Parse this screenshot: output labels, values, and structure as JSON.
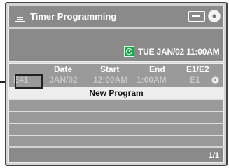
{
  "window": {
    "title": "Timer Programming",
    "left_icon": "menu-icon",
    "right_icons": [
      "media-icon",
      "disc-icon"
    ]
  },
  "status": {
    "clock_icon": "clock-icon",
    "datetime": "TUE JAN/02 11:00AM"
  },
  "table": {
    "columns": [
      "Date",
      "Start",
      "End",
      "E1/E2"
    ],
    "rows": [
      {
        "number": "E41",
        "date": "JAN/02",
        "start": "12:00AM",
        "end": "1:00AM",
        "e1e2": "E1",
        "icon": "disc-icon"
      }
    ],
    "new_program_label": "New Program"
  },
  "footer": {
    "page": "1/1"
  },
  "colors": {
    "panel_background": "#d3d3d3",
    "bar_background": "#8a8a8a",
    "highlight_row": "#ededed",
    "clock_icon_green": "#1aa84a"
  }
}
